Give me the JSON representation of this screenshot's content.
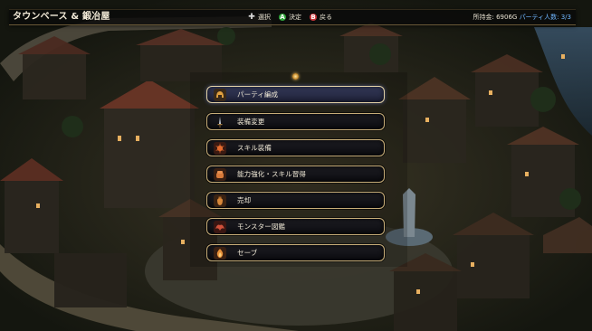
{
  "header": {
    "title": "タウンベース & 鍛冶屋",
    "hints": [
      {
        "icon": "dpad-icon",
        "label": "選択"
      },
      {
        "icon": "a-button-icon",
        "label": "決定"
      },
      {
        "icon": "b-button-icon",
        "label": "戻る"
      }
    ],
    "gold": "所持金: 6906G",
    "party": "パーティ人数: 3/3"
  },
  "menu": {
    "items": [
      {
        "label": "パーティ編成",
        "icon": "party-helmet-icon",
        "selected": true
      },
      {
        "label": "装備変更",
        "icon": "sword-icon",
        "selected": false
      },
      {
        "label": "スキル装備",
        "icon": "skill-sun-icon",
        "selected": false
      },
      {
        "label": "能力強化・スキル習得",
        "icon": "fist-upgrade-icon",
        "selected": false
      },
      {
        "label": "売却",
        "icon": "coin-bag-icon",
        "selected": false
      },
      {
        "label": "モンスター図鑑",
        "icon": "monster-book-icon",
        "selected": false
      },
      {
        "label": "セーブ",
        "icon": "save-flame-icon",
        "selected": false
      }
    ]
  },
  "colors": {
    "accent_border": "#c7ad78",
    "selected_bg": "#2a2e4a",
    "party_text": "#6fb6ff"
  }
}
